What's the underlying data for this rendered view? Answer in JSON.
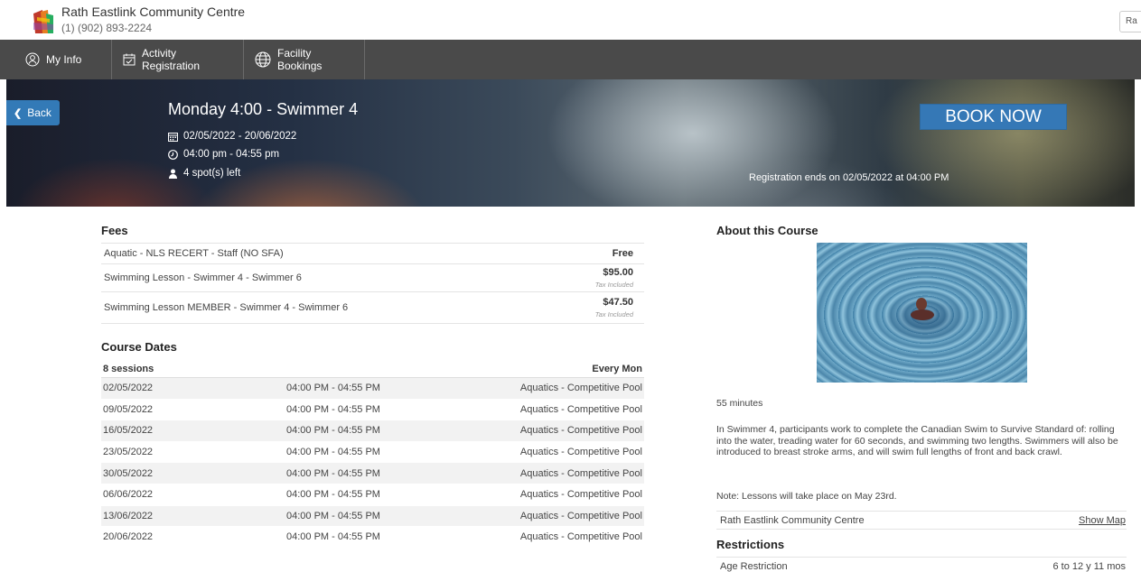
{
  "header": {
    "org_name": "Rath Eastlink Community Centre",
    "phone": "(1) (902) 893-2224",
    "user_chip": "Ra"
  },
  "nav": {
    "items": [
      {
        "label": "My Info",
        "icon": "user-circle-icon"
      },
      {
        "label": "Activity Registration",
        "icon": "calendar-check-icon"
      },
      {
        "label": "Facility Bookings",
        "icon": "globe-icon"
      }
    ]
  },
  "hero": {
    "back_label": "Back",
    "title": "Monday 4:00 - Swimmer 4",
    "date_range": "02/05/2022 - 20/06/2022",
    "time_range": "04:00 pm - 04:55 pm",
    "spots": "4 spot(s) left",
    "book_label": "BOOK NOW",
    "registration_ends": "Registration ends on 02/05/2022 at 04:00 PM"
  },
  "fees": {
    "heading": "Fees",
    "rows": [
      {
        "name": "Aquatic - NLS RECERT - Staff (NO SFA)",
        "price": "Free",
        "tax": ""
      },
      {
        "name": "Swimming Lesson - Swimmer 4 - Swimmer 6",
        "price": "$95.00",
        "tax": "Tax Included"
      },
      {
        "name": "Swimming Lesson MEMBER - Swimmer 4 - Swimmer 6",
        "price": "$47.50",
        "tax": "Tax Included"
      }
    ]
  },
  "course_dates": {
    "heading": "Course Dates",
    "sessions": "8 sessions",
    "frequency": "Every Mon",
    "rows": [
      {
        "date": "02/05/2022",
        "time": "04:00 PM - 04:55 PM",
        "location": "Aquatics - Competitive Pool"
      },
      {
        "date": "09/05/2022",
        "time": "04:00 PM - 04:55 PM",
        "location": "Aquatics - Competitive Pool"
      },
      {
        "date": "16/05/2022",
        "time": "04:00 PM - 04:55 PM",
        "location": "Aquatics - Competitive Pool"
      },
      {
        "date": "23/05/2022",
        "time": "04:00 PM - 04:55 PM",
        "location": "Aquatics - Competitive Pool"
      },
      {
        "date": "30/05/2022",
        "time": "04:00 PM - 04:55 PM",
        "location": "Aquatics - Competitive Pool"
      },
      {
        "date": "06/06/2022",
        "time": "04:00 PM - 04:55 PM",
        "location": "Aquatics - Competitive Pool"
      },
      {
        "date": "13/06/2022",
        "time": "04:00 PM - 04:55 PM",
        "location": "Aquatics - Competitive Pool"
      },
      {
        "date": "20/06/2022",
        "time": "04:00 PM - 04:55 PM",
        "location": "Aquatics - Competitive Pool"
      }
    ]
  },
  "about": {
    "heading": "About this Course",
    "duration": "55 minutes",
    "description": "In Swimmer 4, participants work to complete the Canadian Swim to Survive Standard of: rolling into the water, treading water for 60 seconds, and swimming two lengths. Swimmers will also be introduced to breast stroke arms, and will swim full lengths of front and back crawl.",
    "note": "Note: Lessons will take place on May 23rd.",
    "location_name": "Rath Eastlink Community Centre",
    "show_map": "Show Map"
  },
  "restrictions": {
    "heading": "Restrictions",
    "label": "Age Restriction",
    "value": "6 to 12 y 11 mos"
  }
}
